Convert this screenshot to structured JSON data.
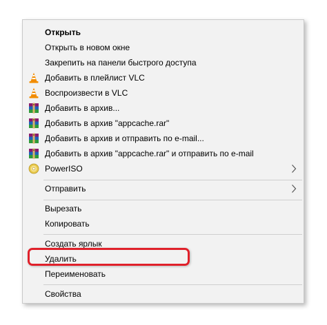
{
  "context_menu": {
    "items": [
      {
        "label": "Открыть",
        "icon": null
      },
      {
        "label": "Открыть в новом окне",
        "icon": null
      },
      {
        "label": "Закрепить на панели быстрого доступа",
        "icon": null
      },
      {
        "label": "Добавить в плейлист VLC",
        "icon": "vlc-cone-icon"
      },
      {
        "label": "Воспроизвести в VLC",
        "icon": "vlc-cone-icon"
      },
      {
        "label": "Добавить в архив...",
        "icon": "winrar-archive-icon"
      },
      {
        "label": "Добавить в архив \"appcache.rar\"",
        "icon": "winrar-archive-icon"
      },
      {
        "label": "Добавить в архив и отправить по e-mail...",
        "icon": "winrar-archive-icon"
      },
      {
        "label": "Добавить в архив \"appcache.rar\" и отправить по e-mail",
        "icon": "winrar-archive-icon"
      },
      {
        "label": "PowerISO",
        "icon": "poweriso-disc-icon"
      },
      {
        "label": "Отправить",
        "icon": null
      },
      {
        "label": "Вырезать",
        "icon": null
      },
      {
        "label": "Копировать",
        "icon": null
      },
      {
        "label": "Создать ярлык",
        "icon": null
      },
      {
        "label": "Удалить",
        "icon": null
      },
      {
        "label": "Переименовать",
        "icon": null
      },
      {
        "label": "Свойства",
        "icon": null
      }
    ]
  },
  "colors": {
    "menu_background": "#f2f2f2",
    "separator": "#cfcfcf",
    "highlight_border": "#e0202a",
    "vlc_orange": "#f28c00"
  }
}
